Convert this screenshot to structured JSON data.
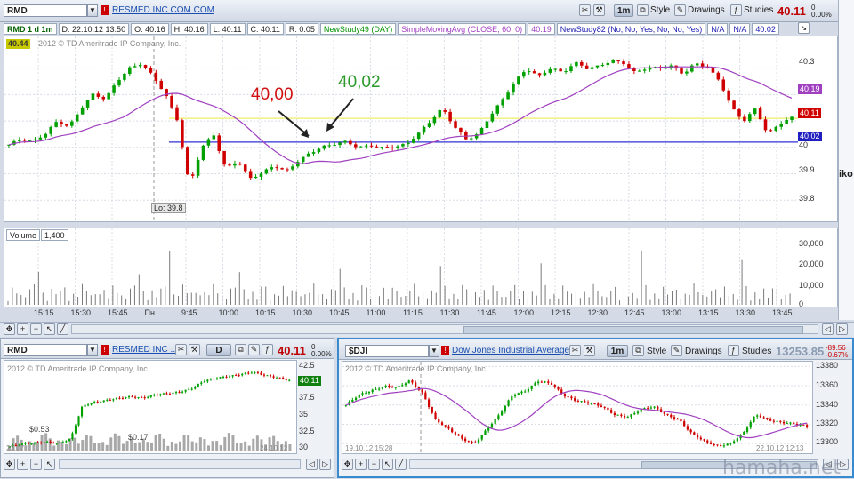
{
  "main": {
    "symbol": "RMD",
    "company": "RESMED INC COM COM",
    "timeframe": "1m",
    "style_label": "Style",
    "drawings_label": "Drawings",
    "studies_label": "Studies",
    "last_price": "40.11",
    "price_change_top": "0",
    "price_change_pct": "0.00%",
    "info": {
      "title": "RMD 1 d 1m",
      "date": "D: 22.10.12 13:50",
      "open": "O: 40.16",
      "high": "H: 40.16",
      "low": "L: 40.11",
      "close": "C: 40.11",
      "range": "R: 0.05",
      "study1": "NewStudy49 (DAY)",
      "study2": "SimpleMovingAvg (CLOSE, 60, 0)",
      "study2_value": "40.19",
      "study3": "NewStudy82 (No, No, Yes, No, No, Yes)",
      "na1": "N/A",
      "na2": "N/A",
      "value3": "40.02"
    },
    "top_left_tag": "40.44",
    "copyright": "2012 © TD Ameritrade IP Company, Inc.",
    "low_label": "Lo: 39.8",
    "annotation_left": "40,00",
    "annotation_right": "40,02",
    "y_ticks": [
      "40.3",
      "40.2",
      "40.1",
      "40",
      "39.9",
      "39.8"
    ],
    "price_tags": {
      "ma": "40.19",
      "last": "40.11",
      "level": "40.02"
    },
    "volume_label": "Volume",
    "volume_value": "1,400",
    "volume_ticks": [
      "30,000",
      "20,000",
      "10,000",
      "0"
    ],
    "x_ticks": [
      "15:15",
      "15:30",
      "15:45",
      "Пн",
      "9:45",
      "10:00",
      "10:15",
      "10:30",
      "10:45",
      "11:00",
      "11:15",
      "11:30",
      "11:45",
      "12:00",
      "12:15",
      "12:30",
      "12:45",
      "13:00",
      "13:15",
      "13:30",
      "13:45"
    ],
    "side_text": "iko"
  },
  "bottom_left": {
    "symbol": "RMD",
    "company": "RESMED INC ...",
    "timeframe": "D",
    "last_price": "40.11",
    "price_change_top": "0",
    "price_change_pct": "0.00%",
    "copyright": "2012 © TD Ameritrade IP Company, Inc.",
    "y_ticks": [
      "42.5",
      "40",
      "37.5",
      "35",
      "32.5",
      "30"
    ],
    "price_tag": "40.11",
    "div_label_1": "$0.53",
    "div_label_2": "$0.17",
    "date_left": "23.07",
    "date_right": "24.10.12"
  },
  "bottom_right": {
    "symbol": "$DJI",
    "company": "Dow Jones Industrial Average",
    "timeframe": "1m",
    "style_label": "Style",
    "drawings_label": "Drawings",
    "studies_label": "Studies",
    "last_price": "13253.85",
    "price_change_top": "-89.56",
    "price_change_pct": "-0.67%",
    "copyright": "2012 © TD Ameritrade IP Company, Inc.",
    "y_ticks": [
      "13380",
      "13360",
      "13340",
      "13320",
      "13300"
    ],
    "date_left": "19.10.12 15:28",
    "date_right": "22.10.12 12:13"
  },
  "watermark": "hamaha.net",
  "colors": {
    "up": "#00a000",
    "down": "#d00000",
    "ma": "#a040c0",
    "level": "#3030d0",
    "yellow": "#f0f080"
  },
  "chart_data": [
    {
      "type": "candlestick",
      "title": "RMD 1 d 1m",
      "y_axis_ticks": [
        40.3,
        40.2,
        40.1,
        40.0,
        39.9,
        39.8
      ],
      "horizontal_levels": [
        40.11,
        40.02
      ],
      "moving_average": {
        "name": "SimpleMovingAvg (CLOSE, 60, 0)",
        "last": 40.19
      },
      "annotations": [
        "40,00",
        "40,02"
      ],
      "low_marker": 39.8,
      "x_labels": [
        "15:15",
        "15:30",
        "15:45",
        "Пн",
        "9:45",
        "10:00",
        "10:15",
        "10:30",
        "10:45",
        "11:00",
        "11:15",
        "11:30",
        "11:45",
        "12:00",
        "12:15",
        "12:30",
        "12:45",
        "13:00",
        "13:15",
        "13:30",
        "13:45"
      ],
      "close_path": [
        40.01,
        40.03,
        40.02,
        40.05,
        40.1,
        40.08,
        40.15,
        40.2,
        40.18,
        40.25,
        40.3,
        40.32,
        40.27,
        40.2,
        40.1,
        39.85,
        40.0,
        40.05,
        39.92,
        39.95,
        39.88,
        39.9,
        39.93,
        39.91,
        39.95,
        39.98,
        40.0,
        40.01,
        40.02,
        40.0,
        40.01,
        40.0,
        40.0,
        40.01,
        40.05,
        40.1,
        40.15,
        40.08,
        40.03,
        40.05,
        40.12,
        40.18,
        40.25,
        40.3,
        40.27,
        40.3,
        40.28,
        40.32,
        40.3,
        40.31,
        40.33,
        40.32,
        40.28,
        40.3,
        40.3,
        40.31,
        40.28,
        40.32,
        40.3,
        40.25,
        40.15,
        40.1,
        40.15,
        40.05,
        40.09,
        40.11
      ],
      "volume_ticks": [
        30000,
        20000,
        10000,
        0
      ]
    },
    {
      "type": "candlestick",
      "title": "RMD D",
      "y_axis_ticks": [
        42.5,
        40,
        37.5,
        35,
        32.5,
        30
      ],
      "last": 40.11,
      "close_path": [
        30.5,
        30.8,
        31,
        31.2,
        30.9,
        31.5,
        36.5,
        37,
        37.2,
        37.5,
        37.8,
        37.6,
        38,
        38.2,
        38.5,
        39,
        40,
        40.5,
        40.8,
        41,
        41.3,
        40.9,
        40.6,
        40.11
      ]
    },
    {
      "type": "candlestick",
      "title": "$DJI 1m",
      "y_axis_ticks": [
        13380,
        13360,
        13340,
        13320,
        13300
      ],
      "last": 13253.85,
      "close_path": [
        13340,
        13350,
        13355,
        13360,
        13358,
        13365,
        13352,
        13325,
        13315,
        13305,
        13300,
        13315,
        13330,
        13350,
        13355,
        13365,
        13362,
        13350,
        13345,
        13342,
        13338,
        13330,
        13328,
        13335,
        13338,
        13330,
        13325,
        13310,
        13302,
        13298,
        13300,
        13310,
        13330,
        13325,
        13322,
        13320,
        13318
      ]
    }
  ]
}
